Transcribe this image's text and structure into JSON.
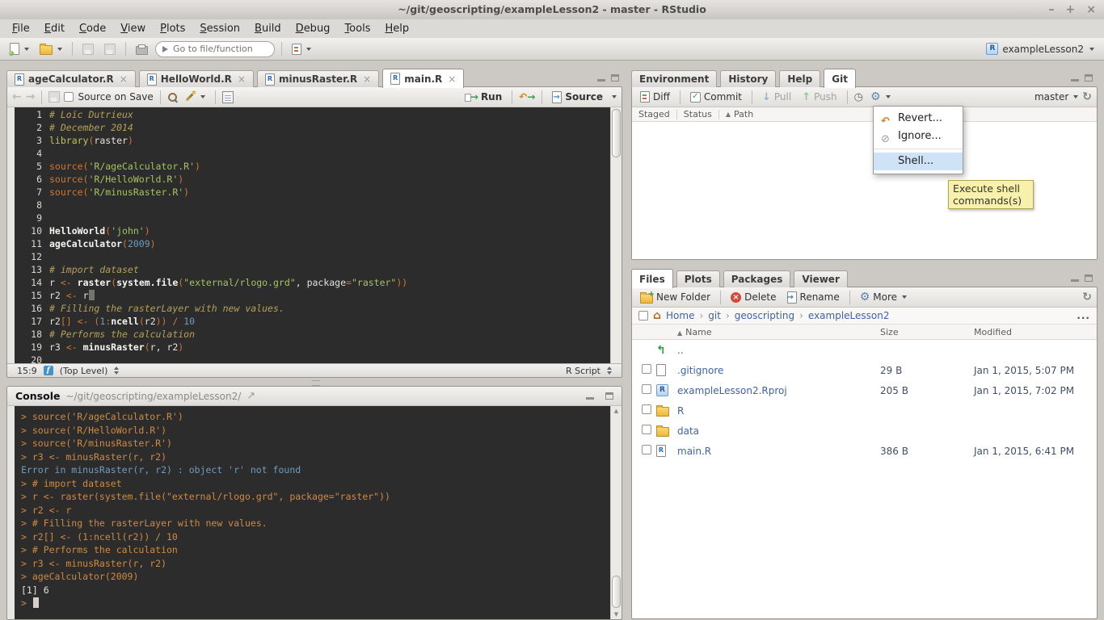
{
  "window": {
    "title": "~/git/geoscripting/exampleLesson2 - master - RStudio",
    "minimize": "–",
    "maximize": "+",
    "close": "×"
  },
  "menubar": {
    "items": [
      "File",
      "Edit",
      "Code",
      "View",
      "Plots",
      "Session",
      "Build",
      "Debug",
      "Tools",
      "Help"
    ]
  },
  "toolbar": {
    "goto_placeholder": "Go to file/function",
    "project": "exampleLesson2"
  },
  "editor": {
    "tabs": [
      {
        "label": "ageCalculator.R"
      },
      {
        "label": "HelloWorld.R"
      },
      {
        "label": "minusRaster.R"
      },
      {
        "label": "main.R",
        "active": true
      }
    ],
    "toolbar": {
      "source_on_save": "Source on Save",
      "run": "Run",
      "source": "Source"
    },
    "lines": [
      {
        "n": 1,
        "tokens": [
          [
            "cm",
            "# Loïc Dutrieux"
          ]
        ]
      },
      {
        "n": 2,
        "tokens": [
          [
            "cm",
            "# December 2014"
          ]
        ]
      },
      {
        "n": 3,
        "tokens": [
          [
            "lib",
            "library"
          ],
          [
            "kw",
            "("
          ],
          [
            "id",
            "raster"
          ],
          [
            "kw",
            ")"
          ]
        ]
      },
      {
        "n": 4,
        "tokens": []
      },
      {
        "n": 5,
        "tokens": [
          [
            "kw",
            "source("
          ],
          [
            "st",
            "'R/ageCalculator.R'"
          ],
          [
            "kw",
            ")"
          ]
        ]
      },
      {
        "n": 6,
        "tokens": [
          [
            "kw",
            "source("
          ],
          [
            "st",
            "'R/HelloWorld.R'"
          ],
          [
            "kw",
            ")"
          ]
        ]
      },
      {
        "n": 7,
        "tokens": [
          [
            "kw",
            "source("
          ],
          [
            "st",
            "'R/minusRaster.R'"
          ],
          [
            "kw",
            ")"
          ]
        ]
      },
      {
        "n": 8,
        "tokens": []
      },
      {
        "n": 9,
        "tokens": []
      },
      {
        "n": 10,
        "tokens": [
          [
            "fn",
            "HelloWorld"
          ],
          [
            "kw",
            "("
          ],
          [
            "st",
            "'john'"
          ],
          [
            "kw",
            ")"
          ]
        ]
      },
      {
        "n": 11,
        "tokens": [
          [
            "fn",
            "ageCalculator"
          ],
          [
            "kw",
            "("
          ],
          [
            "nu",
            "2009"
          ],
          [
            "kw",
            ")"
          ]
        ]
      },
      {
        "n": 12,
        "tokens": []
      },
      {
        "n": 13,
        "tokens": [
          [
            "cm",
            "# import dataset"
          ]
        ]
      },
      {
        "n": 14,
        "tokens": [
          [
            "id",
            "r "
          ],
          [
            "kw",
            "<- "
          ],
          [
            "fn",
            "raster"
          ],
          [
            "kw",
            "("
          ],
          [
            "fn",
            "system.file"
          ],
          [
            "kw",
            "("
          ],
          [
            "st",
            "\"external/rlogo.grd\""
          ],
          [
            "id",
            ", package"
          ],
          [
            "kw",
            "="
          ],
          [
            "st",
            "\"raster\""
          ],
          [
            "kw",
            "))"
          ]
        ]
      },
      {
        "n": 15,
        "tokens": [
          [
            "id",
            "r2 "
          ],
          [
            "kw",
            "<- "
          ],
          [
            "id",
            "r"
          ],
          [
            "cursor",
            ""
          ]
        ]
      },
      {
        "n": 16,
        "tokens": [
          [
            "cm",
            "# Filling the rasterLayer with new values."
          ]
        ]
      },
      {
        "n": 17,
        "tokens": [
          [
            "id",
            "r2"
          ],
          [
            "kw",
            "[] <- ("
          ],
          [
            "nu",
            "1"
          ],
          [
            "kw",
            ":"
          ],
          [
            "fn",
            "ncell"
          ],
          [
            "kw",
            "("
          ],
          [
            "id",
            "r2"
          ],
          [
            "kw",
            ")) / "
          ],
          [
            "nu",
            "10"
          ]
        ]
      },
      {
        "n": 18,
        "tokens": [
          [
            "cm",
            "# Performs the calculation"
          ]
        ]
      },
      {
        "n": 19,
        "tokens": [
          [
            "id",
            "r3 "
          ],
          [
            "kw",
            "<- "
          ],
          [
            "fn",
            "minusRaster"
          ],
          [
            "kw",
            "("
          ],
          [
            "id",
            "r, r2"
          ],
          [
            "kw",
            ")"
          ]
        ]
      },
      {
        "n": 20,
        "tokens": []
      }
    ],
    "status": {
      "position": "15:9",
      "scope": "(Top Level)",
      "doc_type": "R Script"
    }
  },
  "console": {
    "title": "Console",
    "path": "~/git/geoscripting/exampleLesson2/",
    "lines": [
      {
        "type": "in",
        "text": "> source('R/ageCalculator.R')"
      },
      {
        "type": "in",
        "text": "> source('R/HelloWorld.R')"
      },
      {
        "type": "in",
        "text": "> source('R/minusRaster.R')"
      },
      {
        "type": "in",
        "text": "> r3 <- minusRaster(r, r2)"
      },
      {
        "type": "err",
        "text": "Error in minusRaster(r, r2) : object 'r' not found"
      },
      {
        "type": "in",
        "text": "> # import dataset"
      },
      {
        "type": "in",
        "text": "> r <- raster(system.file(\"external/rlogo.grd\", package=\"raster\"))"
      },
      {
        "type": "in",
        "text": "> r2 <- r"
      },
      {
        "type": "in",
        "text": "> # Filling the rasterLayer with new values."
      },
      {
        "type": "in",
        "text": "> r2[] <- (1:ncell(r2)) / 10"
      },
      {
        "type": "in",
        "text": "> # Performs the calculation"
      },
      {
        "type": "in",
        "text": "> r3 <- minusRaster(r, r2)"
      },
      {
        "type": "in",
        "text": "> ageCalculator(2009)"
      },
      {
        "type": "out",
        "text": "[1] 6"
      },
      {
        "type": "in",
        "text": "> ",
        "cursor": true
      }
    ]
  },
  "env_pane": {
    "tabs": [
      {
        "label": "Environment"
      },
      {
        "label": "History"
      },
      {
        "label": "Help"
      },
      {
        "label": "Git",
        "active": true
      }
    ],
    "git_toolbar": {
      "diff": "Diff",
      "commit": "Commit",
      "pull": "Pull",
      "push": "Push",
      "branch": "master"
    },
    "columns": [
      "Staged",
      "Status",
      "Path"
    ],
    "menu": {
      "items": [
        {
          "label": "Revert...",
          "icon": "revert"
        },
        {
          "label": "Ignore...",
          "icon": "ignore"
        },
        {
          "label": "Shell...",
          "highlighted": true
        }
      ]
    },
    "tooltip": "Execute shell commands(s)"
  },
  "files_pane": {
    "tabs": [
      {
        "label": "Files",
        "active": true
      },
      {
        "label": "Plots"
      },
      {
        "label": "Packages"
      },
      {
        "label": "Viewer"
      }
    ],
    "toolbar": {
      "new_folder": "New Folder",
      "delete": "Delete",
      "rename": "Rename",
      "more": "More"
    },
    "breadcrumb": [
      "Home",
      "git",
      "geoscripting",
      "exampleLesson2"
    ],
    "columns": {
      "name": "Name",
      "size": "Size",
      "modified": "Modified"
    },
    "rows": [
      {
        "icon": "up",
        "name": "..",
        "size": "",
        "modified": ""
      },
      {
        "icon": "file",
        "name": ".gitignore",
        "size": "29 B",
        "modified": "Jan 1, 2015, 5:07 PM"
      },
      {
        "icon": "rproj",
        "name": "exampleLesson2.Rproj",
        "size": "205 B",
        "modified": "Jan 1, 2015, 7:02 PM"
      },
      {
        "icon": "folder",
        "name": "R",
        "size": "",
        "modified": ""
      },
      {
        "icon": "folder",
        "name": "data",
        "size": "",
        "modified": ""
      },
      {
        "icon": "rfile",
        "name": "main.R",
        "size": "386 B",
        "modified": "Jan 1, 2015, 6:41 PM"
      }
    ]
  }
}
